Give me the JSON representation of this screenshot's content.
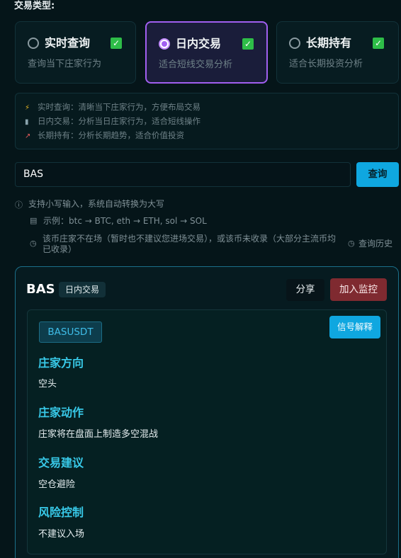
{
  "trade_type_label": "交易类型:",
  "modes": [
    {
      "title": "实时查询",
      "desc": "查询当下庄家行为",
      "selected": false,
      "checked": true
    },
    {
      "title": "日内交易",
      "desc": "适合短线交易分析",
      "selected": true,
      "checked": true
    },
    {
      "title": "长期持有",
      "desc": "适合长期投资分析",
      "selected": false,
      "checked": true
    }
  ],
  "mode_info": [
    {
      "icon": "lightning-icon",
      "glyph": "⚡",
      "color": "#e6b422",
      "text": "实时查询：清晰当下庄家行为，方便布局交易"
    },
    {
      "icon": "bar-chart-icon",
      "glyph": "📊",
      "color": "#8aa4ad",
      "text": "日内交易：分析当日庄家行为，适合短线操作"
    },
    {
      "icon": "trend-chart-icon",
      "glyph": "📈",
      "color": "#e05a5a",
      "text": "长期持有：分析长期趋势，适合价值投资"
    }
  ],
  "search": {
    "value": "BAS",
    "button_label": "查询"
  },
  "hints": {
    "uppercase_note": "支持小写输入，系统自动转换为大写",
    "example": "示例：btc → BTC, eth → ETH, sol → SOL",
    "warning_line1": "该币庄家不在场（暂时也不建议您进场交易），或该币未收录（大部分主流币均",
    "warning_line2": "已收录）",
    "history_label": "查询历史"
  },
  "result": {
    "symbol": "BAS",
    "mode_badge": "日内交易",
    "share_label": "分享",
    "monitor_label": "加入监控",
    "pair": "BASUSDT",
    "explain_label": "信号解释",
    "sections": [
      {
        "heading": "庄家方向",
        "value": "空头"
      },
      {
        "heading": "庄家动作",
        "value": "庄家将在盘面上制造多空混战"
      },
      {
        "heading": "交易建议",
        "value": "空仓避险"
      },
      {
        "heading": "风险控制",
        "value": "不建议入场"
      }
    ]
  },
  "colors": {
    "background": "#051519",
    "accent_cyan": "#0fa7e0",
    "accent_purple": "#a15ff0",
    "heading_cyan": "#38c9e8",
    "monitor_red": "#7f2a30",
    "check_green": "#2ebd48"
  }
}
